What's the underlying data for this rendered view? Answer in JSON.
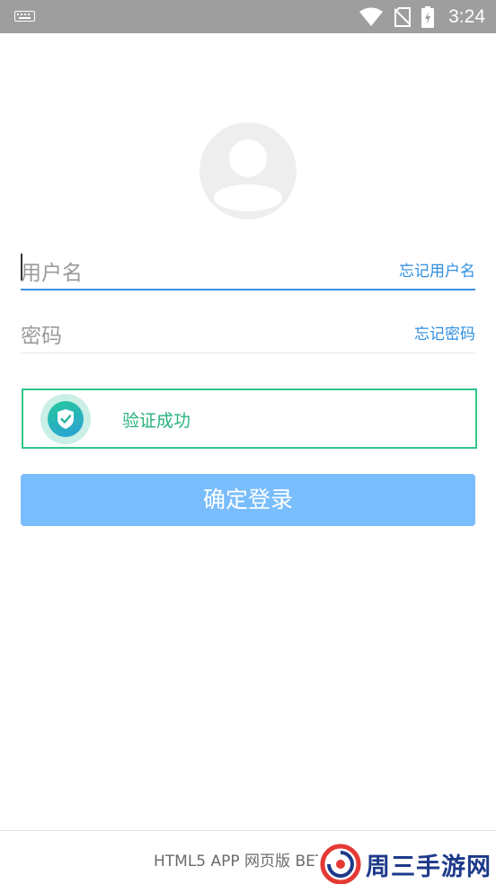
{
  "status_bar": {
    "time": "3:24"
  },
  "form": {
    "username_placeholder": "用户名",
    "forgot_username": "忘记用户名",
    "password_placeholder": "密码",
    "forgot_password": "忘记密码"
  },
  "verification": {
    "status_text": "验证成功"
  },
  "login_button": "确定登录",
  "footer": {
    "version_text": "HTML5 APP 网页版 BETA"
  },
  "watermark": {
    "text": "周三手游网"
  },
  "colors": {
    "accent": "#2f8ee0",
    "button": "#79bdfc",
    "success": "#29b37d",
    "status_bar": "#9e9e9e"
  }
}
